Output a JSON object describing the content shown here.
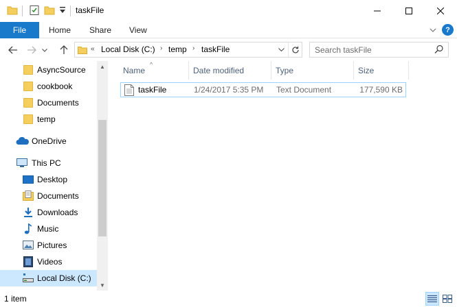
{
  "window": {
    "title": "taskFile",
    "minimize_glyph": "—",
    "maximize_glyph": "☐",
    "close_glyph": "✕"
  },
  "ribbon": {
    "tabs": [
      "File",
      "Home",
      "Share",
      "View"
    ],
    "expand_glyph": "⌄",
    "help_glyph": "?"
  },
  "nav": {
    "back_glyph": "←",
    "forward_glyph": "→",
    "recent_glyph": "⌄",
    "up_glyph": "↑",
    "address": {
      "overflow": "«",
      "crumbs": [
        "Local Disk (C:)",
        "temp",
        "taskFile"
      ],
      "separator": "›",
      "dropdown_glyph": "⌄",
      "refresh_glyph": "↻"
    },
    "search_placeholder": "Search taskFile"
  },
  "sidebar": {
    "items": [
      {
        "label": "AsyncSource",
        "icon": "folder-icon"
      },
      {
        "label": "cookbook",
        "icon": "folder-icon"
      },
      {
        "label": "Documents",
        "icon": "folder-icon"
      },
      {
        "label": "temp",
        "icon": "folder-icon"
      },
      {
        "label": "OneDrive",
        "icon": "onedrive-icon"
      },
      {
        "label": "This PC",
        "icon": "computer-icon"
      },
      {
        "label": "Desktop",
        "icon": "desktop-icon"
      },
      {
        "label": "Documents",
        "icon": "documents-icon"
      },
      {
        "label": "Downloads",
        "icon": "downloads-icon"
      },
      {
        "label": "Music",
        "icon": "music-icon"
      },
      {
        "label": "Pictures",
        "icon": "pictures-icon"
      },
      {
        "label": "Videos",
        "icon": "videos-icon"
      },
      {
        "label": "Local Disk (C:)",
        "icon": "local-disk-icon"
      }
    ],
    "scroll_up": "▲",
    "scroll_down": "▼"
  },
  "columns": {
    "name": "Name",
    "date": "Date modified",
    "type": "Type",
    "size": "Size",
    "sort_glyph": "^"
  },
  "files": [
    {
      "name": "taskFile",
      "date": "1/24/2017 5:35 PM",
      "type": "Text Document",
      "size": "177,590 KB"
    }
  ],
  "status": {
    "count": "1 item"
  },
  "colors": {
    "accent": "#1979ca",
    "selection": "#cce8ff",
    "folder": "#f5cf5e",
    "header_text": "#4c607a"
  }
}
